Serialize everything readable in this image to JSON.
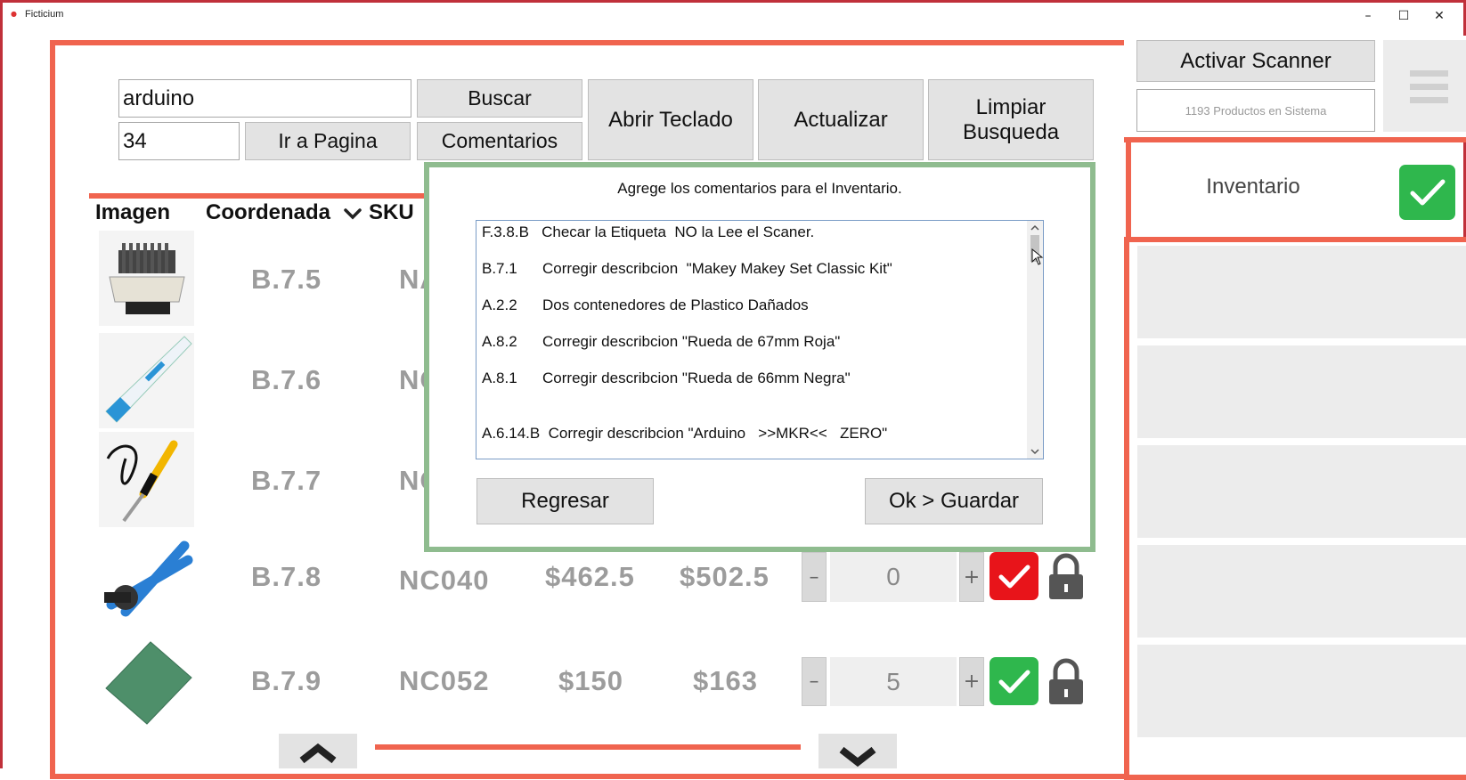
{
  "window": {
    "title": "Ficticium",
    "minimize_glyph": "–",
    "maximize_glyph": "☐",
    "close_glyph": "✕"
  },
  "search": {
    "query_value": "arduino",
    "page_value": "34",
    "search_label": "Buscar",
    "go_page_label": "Ir a Pagina",
    "comments_label": "Comentarios",
    "open_keyboard_label": "Abrir Teclado",
    "refresh_label": "Actualizar",
    "clear_search_label": "Limpiar Busqueda"
  },
  "scanner": {
    "activate_label": "Activar Scanner",
    "product_count": "1193 Productos en Sistema",
    "menu_icon": "hamburger-menu-icon"
  },
  "inventory": {
    "label": "Inventario",
    "check_icon": "checkmark-icon",
    "check_color": "#2fb74d"
  },
  "table": {
    "headers": {
      "image": "Imagen",
      "coordinate": "Coordenada",
      "sku": "SKU"
    },
    "sort_icon": "chevron-down-icon",
    "rows": [
      {
        "coordinate": "B.7.5",
        "sku": "NA",
        "image": "peltier-cooler-image"
      },
      {
        "coordinate": "B.7.6",
        "sku": "NC",
        "image": "flux-pen-image"
      },
      {
        "coordinate": "B.7.7",
        "sku": "NC",
        "image": "soldering-iron-image"
      },
      {
        "coordinate": "B.7.8",
        "sku": "NC040",
        "cost": "$462.5",
        "price": "$502.5",
        "quantity": "0",
        "status_color": "#e8141a",
        "image": "crimping-pliers-image"
      },
      {
        "coordinate": "B.7.9",
        "sku": "NC052",
        "cost": "$150",
        "price": "$163",
        "quantity": "5",
        "status_color": "#2fb74d",
        "image": "perfboard-image"
      }
    ],
    "minus_label": "–",
    "plus_label": "+"
  },
  "dialog": {
    "prompt": "Agrege los comentarios para el Inventario.",
    "lines": [
      "F.3.8.B   Checar la Etiqueta  NO la Lee el Scaner.",
      "B.7.1      Corregir describcion  \"Makey Makey Set Classic Kit\"",
      "A.2.2      Dos contenedores de Plastico Dañados",
      "A.8.2      Corregir describcion \"Rueda de 67mm Roja\"",
      "A.8.1      Corregir describcion \"Rueda de 66mm Negra\"",
      "",
      "A.6.14.B  Corregir describcion \"Arduino   >>MKR<<   ZERO\""
    ],
    "back_label": "Regresar",
    "save_label": "Ok > Guardar"
  },
  "colors": {
    "accent_red": "#f0644f",
    "dialog_border": "#8fbc8f",
    "window_border": "#c0303a"
  }
}
